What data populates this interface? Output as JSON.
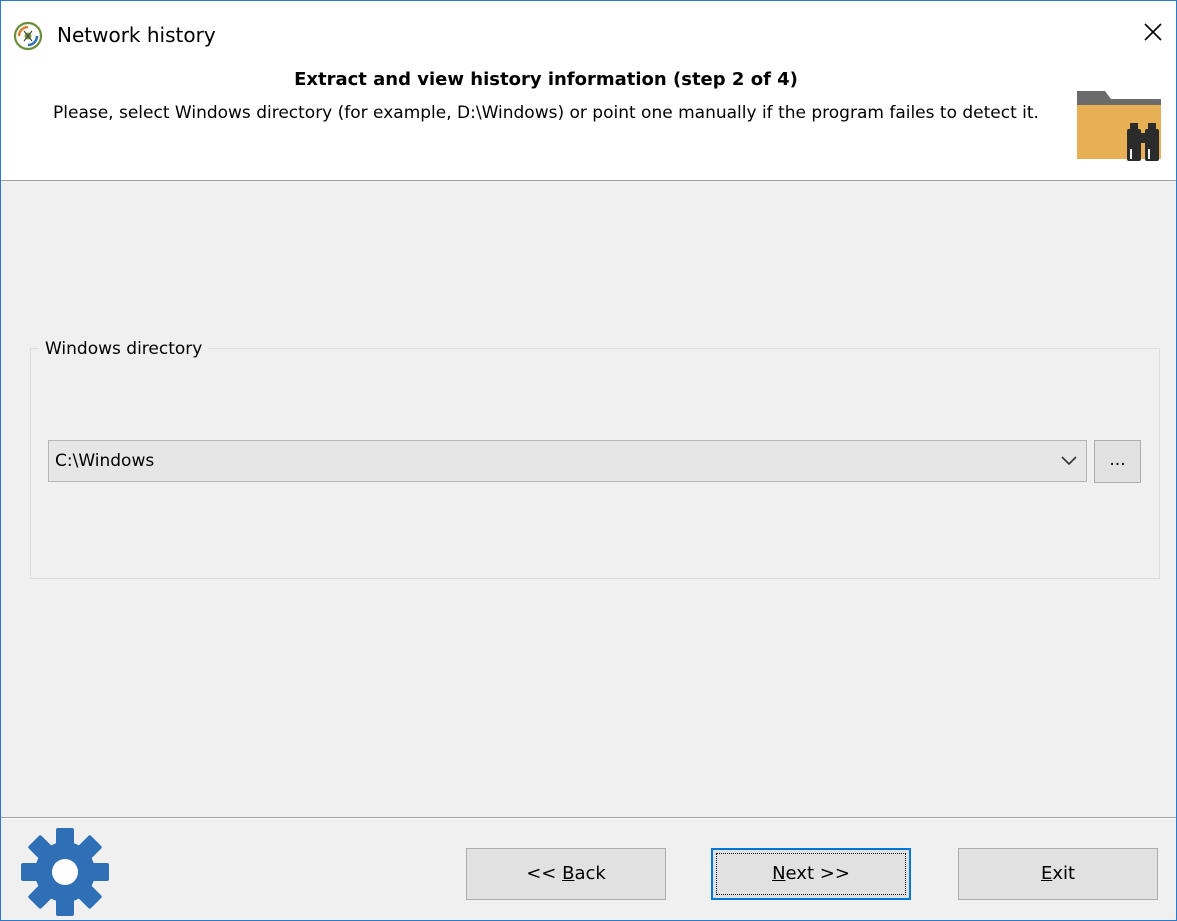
{
  "window": {
    "title": "Network history",
    "app_icon": "network-history-app-icon",
    "close_icon": "close-icon"
  },
  "header": {
    "title": "Extract and view history information (step 2 of 4)",
    "description": "Please, select Windows directory (for example, D:\\Windows) or point one manually if the program failes to detect it.",
    "icon": "folder-binoculars-icon"
  },
  "group": {
    "legend": "Windows directory",
    "directory_value": "C:\\Windows",
    "dropdown_icon": "chevron-down-icon",
    "browse_label": "..."
  },
  "footer": {
    "gear_icon": "gear-icon",
    "back_prefix": "<< ",
    "back_mnemonic": "B",
    "back_rest": "ack",
    "next_mnemonic": "N",
    "next_rest": "ext >>",
    "exit_mnemonic": "E",
    "exit_rest": "xit"
  },
  "colors": {
    "accent": "#0078d7",
    "window_border": "#2b79c9",
    "folder": "#e8b055",
    "gear": "#2f6fb5"
  }
}
